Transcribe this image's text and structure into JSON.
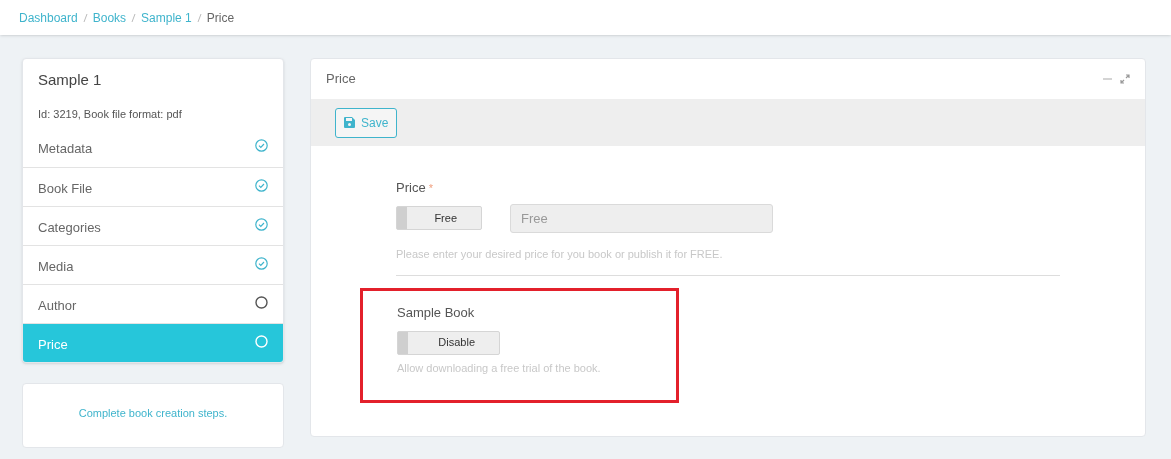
{
  "breadcrumb": [
    {
      "label": "Dashboard",
      "current": false
    },
    {
      "label": "Books",
      "current": false
    },
    {
      "label": "Sample 1",
      "current": false
    },
    {
      "label": "Price",
      "current": true
    }
  ],
  "book": {
    "title": "Sample 1",
    "info": "Id: 3219, Book file format: pdf"
  },
  "steps": [
    {
      "label": "Metadata",
      "done": true,
      "selected": false
    },
    {
      "label": "Book File",
      "done": true,
      "selected": false
    },
    {
      "label": "Categories",
      "done": true,
      "selected": false
    },
    {
      "label": "Media",
      "done": true,
      "selected": false
    },
    {
      "label": "Author",
      "done": false,
      "selected": false
    },
    {
      "label": "Price",
      "done": false,
      "selected": true
    }
  ],
  "note": "Complete book creation steps.",
  "panel": {
    "title": "Price",
    "save_button": "Save",
    "price": {
      "label": "Price",
      "required_mark": "*",
      "toggle": {
        "label": "Free",
        "on": false
      },
      "input": {
        "value": "Free",
        "disabled": true
      },
      "help": "Please enter your desired price for you book or publish it for FREE."
    },
    "sample_book": {
      "label": "Sample Book",
      "highlighted": true,
      "toggle": {
        "label": "Disable",
        "on": false
      },
      "help": "Allow downloading a free trial of the book."
    }
  }
}
